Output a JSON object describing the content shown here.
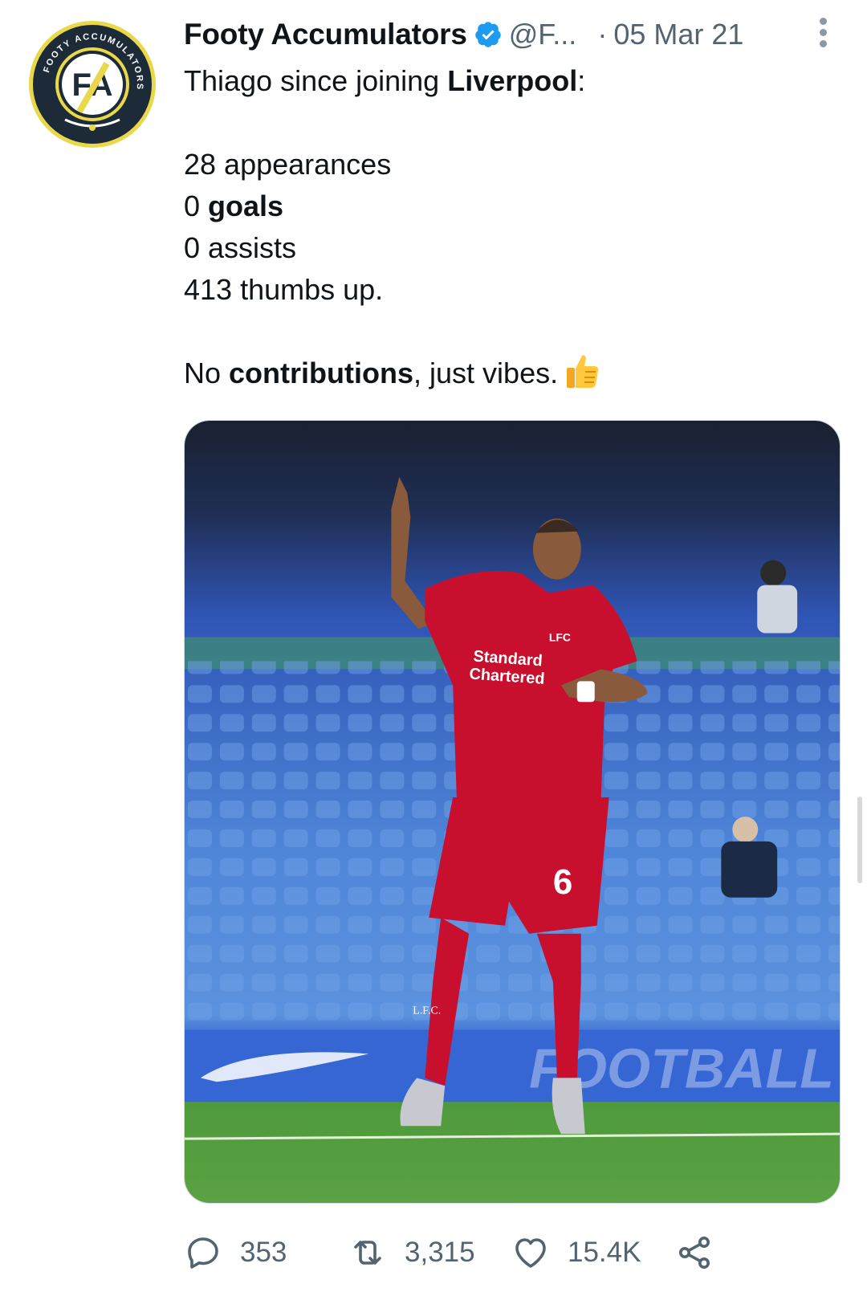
{
  "tweet": {
    "author_name": "Footy Accumulators",
    "handle": "@F...",
    "separator": "·",
    "date": "05 Mar 21",
    "avatar": {
      "ring_text": "FOOTY ACCUMULATORS",
      "monogram": "FA",
      "icon": "footy-accumulators-logo"
    },
    "text": {
      "line1_prefix": "Thiago since joining ",
      "line1_bold": "Liverpool",
      "line1_suffix": ":",
      "stat1": "28 appearances",
      "stat2_prefix": "0 ",
      "stat2_bold": "goals",
      "stat3": "0 assists",
      "stat4": "413 thumbs up.",
      "closing_prefix": "No ",
      "closing_bold": "contributions",
      "closing_suffix": ", just vibes.",
      "emoji": "thumbs-up-emoji"
    },
    "media": {
      "description_icon": "football-player-photo",
      "shirt_sponsor_line1": "Standard",
      "shirt_sponsor_line2": "Chartered",
      "shirt_number": "6",
      "crest_text": "LFC",
      "sock_text": "L.F.C."
    },
    "actions": {
      "reply_count": "353",
      "retweet_count": "3,315",
      "like_count": "15.4K"
    }
  },
  "colors": {
    "text_primary": "#0f1419",
    "text_secondary": "#536471",
    "verified_blue": "#1d9bf0",
    "logo_yellow": "#e9d94a",
    "logo_navy": "#1d2a38"
  }
}
